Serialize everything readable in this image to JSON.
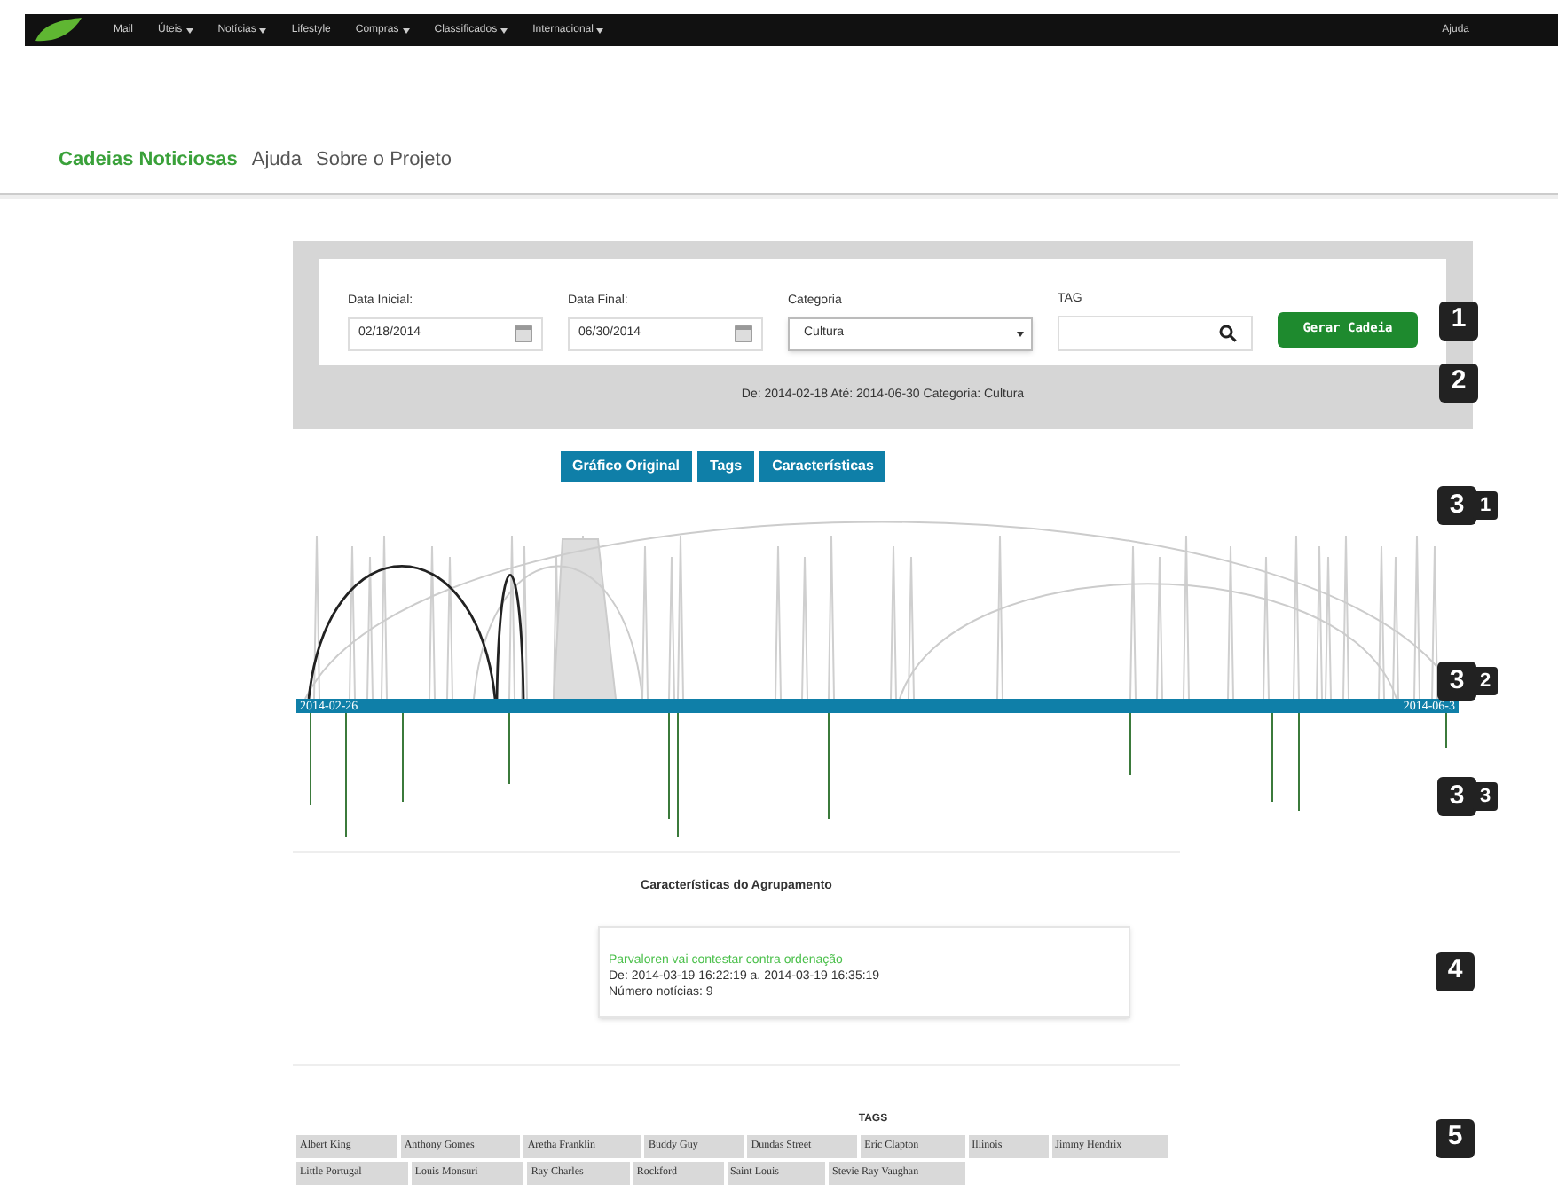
{
  "top_menu": {
    "items": [
      {
        "label": "Mail",
        "dropdown": false
      },
      {
        "label": "Úteis",
        "dropdown": true
      },
      {
        "label": "Notícias",
        "dropdown": true
      },
      {
        "label": "Lifestyle",
        "dropdown": false
      },
      {
        "label": "Compras",
        "dropdown": true
      },
      {
        "label": "Classificados",
        "dropdown": true
      },
      {
        "label": "Internacional",
        "dropdown": true
      }
    ],
    "right_link": "Ajuda"
  },
  "nav": [
    {
      "label": "Cadeias Noticiosas",
      "selected": true
    },
    {
      "label": "Ajuda",
      "selected": false
    },
    {
      "label": "Sobre o Projeto",
      "selected": false
    }
  ],
  "filters": {
    "start_date": {
      "label": "Data Inicial:",
      "value": "02/18/2014"
    },
    "end_date": {
      "label": "Data Final:",
      "value": "06/30/2014"
    },
    "category": {
      "label": "Categoria",
      "value": "Cultura"
    },
    "tag": {
      "label": "TAG"
    },
    "submit": "Gerar Cadeia",
    "summary": "De: 2014-02-18 Até: 2014-06-30 Categoria: Cultura"
  },
  "view_tabs": [
    {
      "label": "Gráfico Original"
    },
    {
      "label": "Tags"
    },
    {
      "label": "Características"
    }
  ],
  "timeline": {
    "start_label": "2014-02-26",
    "end_label": "2014-06-3"
  },
  "cluster": {
    "heading": "Características do Agrupamento",
    "title": "Parvaloren vai contestar contra ordenação",
    "range": "De: 2014-03-19 16:22:19 a. 2014-03-19 16:35:19",
    "count": "Número notícias: 9"
  },
  "tags": {
    "heading": "TAGS",
    "rows": [
      [
        "Albert King",
        "Anthony Gomes",
        "Aretha Franklin",
        "Buddy Guy",
        "Dundas Street",
        "Eric Clapton",
        "Illinois",
        "Jimmy Hendrix"
      ],
      [
        "Little Portugal",
        "Louis Monsuri",
        "Ray Charles",
        "Rockford",
        "Saint Louis",
        "Stevie Ray Vaughan"
      ]
    ]
  },
  "markers": [
    {
      "main": "1"
    },
    {
      "main": "2"
    },
    {
      "main": "3",
      "sub": "1"
    },
    {
      "main": "3",
      "sub": "2"
    },
    {
      "main": "3",
      "sub": "3"
    },
    {
      "main": "4"
    },
    {
      "main": "5"
    }
  ]
}
